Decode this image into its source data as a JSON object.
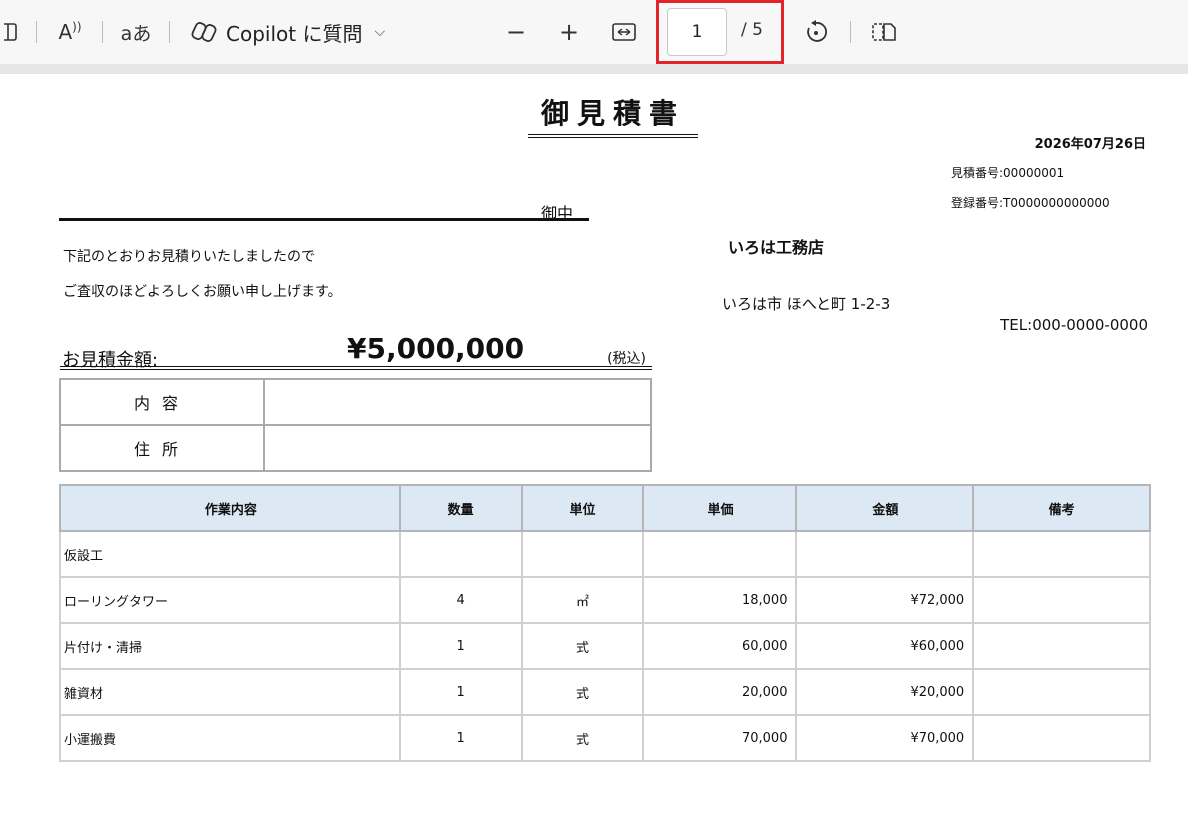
{
  "toolbar": {
    "copilot_label": "Copilot に質問",
    "page_current": "1",
    "page_total": "/ 5",
    "read_aloud_label": "A",
    "translate_label": "aあ"
  },
  "document": {
    "title": "御見積書",
    "date": "2026年07月26日",
    "estimate_number": "見積番号:00000001",
    "registration_number": "登録番号:T0000000000000",
    "recipient_suffix": "御中",
    "message_line1": "下記のとおりお見積りいたしましたので",
    "message_line2": "ご査収のほどよろしくお願い申し上げます。",
    "company_name": "いろは工務店",
    "address": "いろは市 ほへと町 1-2-3",
    "tel": "TEL:000-0000-0000",
    "amount_label": "お見積金額:",
    "amount_value": "¥5,000,000",
    "tax_note": "(税込)",
    "info_rows": [
      {
        "label": "内容",
        "value": ""
      },
      {
        "label": "住所",
        "value": ""
      }
    ],
    "table_headers": [
      "作業内容",
      "数量",
      "単位",
      "単価",
      "金額",
      "備考"
    ],
    "table_rows": [
      {
        "name": "仮設工",
        "qty": "",
        "unit": "",
        "price": "",
        "amount": "",
        "note": ""
      },
      {
        "name": "ローリングタワー",
        "qty": "4",
        "unit": "㎡",
        "price": "18,000",
        "amount": "¥72,000",
        "note": ""
      },
      {
        "name": "片付け・清掃",
        "qty": "1",
        "unit": "式",
        "price": "60,000",
        "amount": "¥60,000",
        "note": ""
      },
      {
        "name": "雑資材",
        "qty": "1",
        "unit": "式",
        "price": "20,000",
        "amount": "¥20,000",
        "note": ""
      },
      {
        "name": "小運搬費",
        "qty": "1",
        "unit": "式",
        "price": "70,000",
        "amount": "¥70,000",
        "note": ""
      }
    ]
  }
}
